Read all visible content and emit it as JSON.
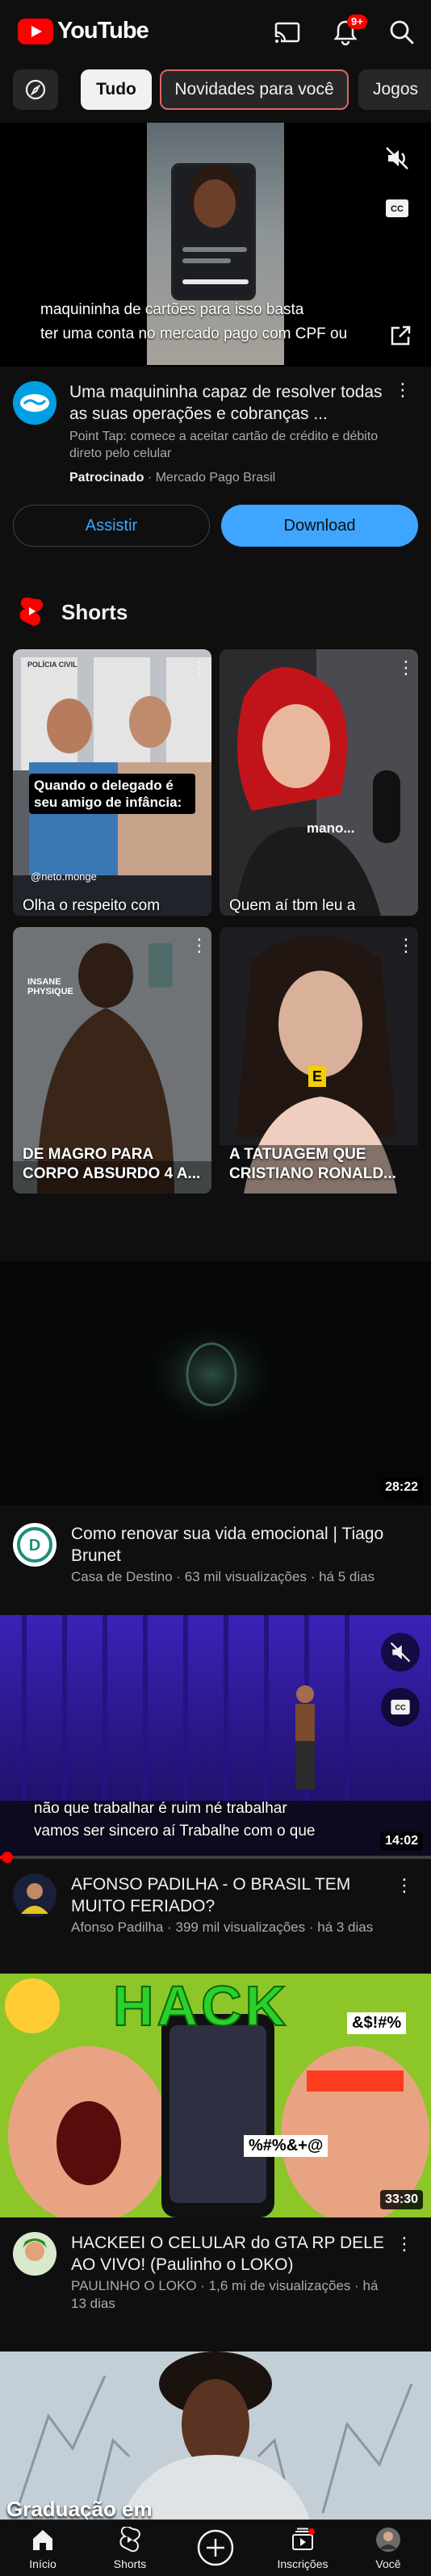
{
  "header": {
    "logo_text": "YouTube",
    "notification_count": "9+",
    "icons": [
      "cast-icon",
      "bell-icon",
      "search-icon"
    ]
  },
  "chips": {
    "explore_icon": "compass-icon",
    "items": [
      {
        "label": "Tudo",
        "selected": true
      },
      {
        "label": "Novidades para você",
        "selected": false
      },
      {
        "label": "Jogos",
        "selected": false
      }
    ]
  },
  "ad": {
    "caption_line1": "maquininha de cartões para isso basta",
    "caption_line2": "ter uma conta no mercado pago com CPF ou",
    "title": "Uma maquininha capaz de resolver todas as suas operações e cobranças ...",
    "subtitle": "Point Tap: comece a aceitar cartão de crédito e débito direto pelo celular",
    "sponsored_label": "Patrocinado",
    "advertiser": "Mercado Pago Brasil",
    "watch_button": "Assistir",
    "download_button": "Download"
  },
  "shorts": {
    "section_title": "Shorts",
    "items": [
      {
        "title": "Olha o respeito com",
        "overlay_text": "Quando o delegado é seu amigo de infância:",
        "handle": "@neto.monge",
        "sign_text": "POLÍCIA CIVIL"
      },
      {
        "title": "Quem aí tbm leu a",
        "overlay_text": "mano..."
      },
      {
        "title": "DE MAGRO PARA CORPO ABSURDO 4 A...",
        "badge": "INSANE PHYSIQUE"
      },
      {
        "title": "A TATUAGEM QUE CRISTIANO RONALD...",
        "badge": "E"
      }
    ]
  },
  "videos": [
    {
      "title": "Como renovar sua vida emocional | Tiago Brunet",
      "channel": "Casa de Destino",
      "views": "63 mil visualizações",
      "age": "há 5 dias",
      "duration": "28:22"
    },
    {
      "title": "AFONSO PADILHA - O BRASIL TEM MUITO FERIADO?",
      "channel": "Afonso Padilha",
      "views": "399 mil visualizações",
      "age": "há 3 dias",
      "duration": "14:02",
      "caption_line1": "não que trabalhar é ruim né trabalhar",
      "caption_line2": "vamos ser sincero aí Trabalhe com o que"
    },
    {
      "title": "HACKEEI O CELULAR do GTA RP DELE AO VIVO! (Paulinho o LOKO)",
      "channel": "PAULINHO O LOKO",
      "views": "1,6 mi de visualizações",
      "age": "há 13 dias",
      "duration": "33:30",
      "thumb_text": "HACK",
      "censor_text_1": "&$!#%",
      "censor_text_2": "%#%&+@"
    },
    {
      "thumb_text": "Graduação em"
    }
  ],
  "bottom_nav": [
    {
      "label": "Início",
      "icon": "home-icon"
    },
    {
      "label": "Shorts",
      "icon": "shorts-icon"
    },
    {
      "label": "",
      "icon": "create-plus-icon"
    },
    {
      "label": "Inscrições",
      "icon": "subscriptions-icon"
    },
    {
      "label": "Você",
      "icon": "avatar-icon"
    }
  ],
  "colors": {
    "background": "#0f0f0f",
    "brand_red": "#ff0000",
    "accent_blue": "#3ea6ff",
    "text_secondary": "#aaaaaa"
  }
}
